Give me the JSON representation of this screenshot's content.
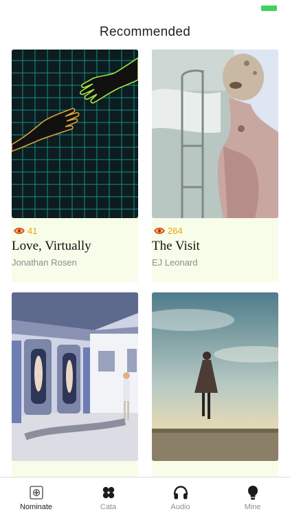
{
  "page": {
    "title": "Recommended"
  },
  "cards": [
    {
      "title": "Love, Virtually",
      "author": "Jonathan Rosen",
      "views": "41"
    },
    {
      "title": "The Visit",
      "author": "EJ Leonard",
      "views": "264"
    },
    {
      "title": "",
      "author": "",
      "views": ""
    },
    {
      "title": "",
      "author": "",
      "views": ""
    }
  ],
  "tabs": [
    {
      "label": "Nominate",
      "icon": "nominate-icon",
      "active": true
    },
    {
      "label": "Cata",
      "icon": "clover-icon",
      "active": false
    },
    {
      "label": "Audio",
      "icon": "headphones-icon",
      "active": false
    },
    {
      "label": "Mine",
      "icon": "profile-icon",
      "active": false
    }
  ],
  "colors": {
    "card_bg": "#f7fde8",
    "views_accent": "#f2a007",
    "battery": "#43d15d"
  }
}
